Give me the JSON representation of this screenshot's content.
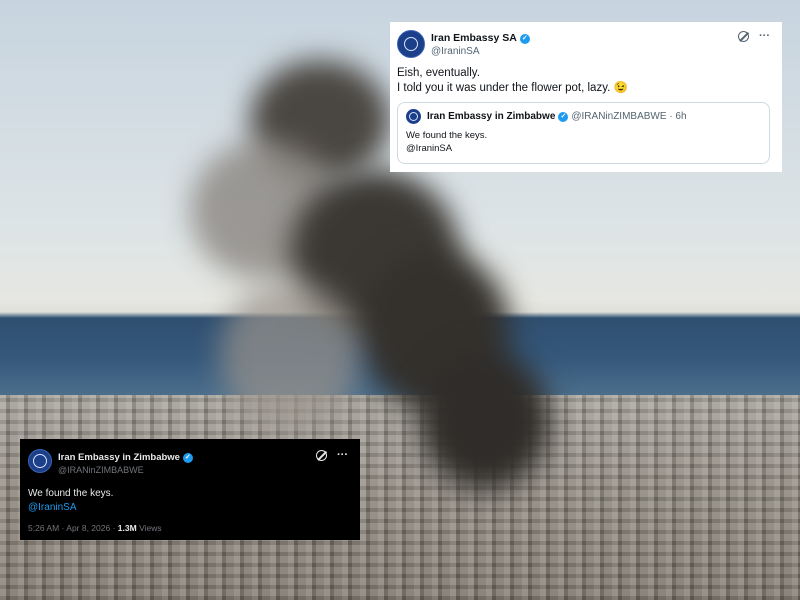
{
  "tweet_top": {
    "display_name": "Iran Embassy SA",
    "handle": "@IraninSA",
    "text_line1": "Eish, eventually.",
    "text_line2": "I told you it was under the flower pot, lazy. 😉",
    "quote": {
      "display_name": "Iran Embassy in Zimbabwe",
      "handle": "@IRANinZIMBABWE · 6h",
      "text_line1": "We found the keys.",
      "mention": "@IraninSA"
    }
  },
  "tweet_bottom": {
    "display_name": "Iran Embassy in Zimbabwe",
    "handle": "@IRANinZIMBABWE",
    "text_line1": "We found the keys.",
    "mention": "@IraninSA",
    "timestamp": "5:26 AM · Apr 8, 2026 ·",
    "views_count": "1.3M",
    "views_label": "Views"
  },
  "icons": {
    "verified": "✓",
    "more": "···"
  },
  "colors": {
    "accent": "#1d9bf0",
    "avatar": "#1c3f8a"
  }
}
